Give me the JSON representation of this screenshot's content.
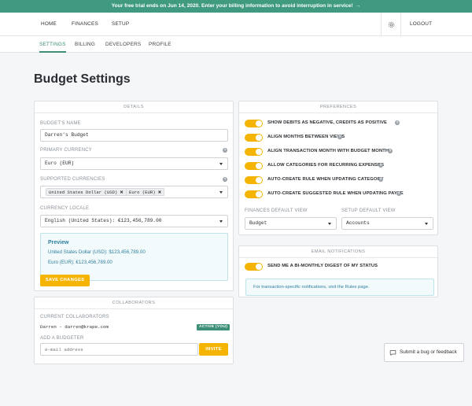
{
  "banner": {
    "text": "Your free trial ends on Jun 14, 2020. Enter your billing information to avoid interruption in service!",
    "arrow": "→"
  },
  "topnav": {
    "home": "HOME",
    "finances": "FINANCES",
    "setup": "SETUP",
    "logout": "LOGOUT",
    "settings_icon": "gear-icon"
  },
  "subnav": {
    "settings": "SETTINGS",
    "billing": "BILLING",
    "developers": "DEVELOPERS",
    "profile": "PROFILE"
  },
  "page": {
    "title": "Budget Settings"
  },
  "details": {
    "header": "DETAILS",
    "budget_name_label": "BUDGET'S NAME",
    "budget_name_value": "Darren's Budget",
    "primary_currency_label": "PRIMARY CURRENCY",
    "primary_currency_value": "Euro (EUR)",
    "supported_currencies_label": "SUPPORTED CURRENCIES",
    "supported_currencies": [
      "United States Dollar (USD)",
      "Euro (EUR)"
    ],
    "currency_locale_label": "CURRENCY LOCALE",
    "currency_locale_value": "English (United States): €123,456,789.00",
    "preview_title": "Preview",
    "preview_lines": [
      "United States Dollar (USD): $123,456,789.00",
      "Euro (EUR): €123,456,789.00"
    ],
    "save_button": "SAVE CHANGES"
  },
  "collaborators": {
    "header": "COLLABORATORS",
    "current_label": "CURRENT COLLABORATORS",
    "current_user": "Darren - darren@krape.com",
    "status_badge": "ACTIVE (YOU)",
    "add_label": "ADD A BUDGETER",
    "email_placeholder": "e-mail address",
    "invite_button": "INVITE"
  },
  "preferences": {
    "header": "PREFERENCES",
    "toggles": [
      {
        "label": "SHOW DEBITS AS NEGATIVE, CREDITS AS POSITIVE",
        "on": true
      },
      {
        "label": "ALIGN MONTHS BETWEEN VIEWS",
        "on": true
      },
      {
        "label": "ALIGN TRANSACTION MONTH WITH BUDGET MONTH",
        "on": true
      },
      {
        "label": "ALLOW CATEGORIES FOR RECURRING EXPENSES",
        "on": true
      },
      {
        "label": "AUTO-CREATE RULE WHEN UPDATING CATEGORY",
        "on": true
      },
      {
        "label": "AUTO-CREATE SUGGESTED RULE WHEN UPDATING PAYEE",
        "on": true
      }
    ],
    "finances_default_view_label": "FINANCES DEFAULT VIEW",
    "finances_default_view_value": "Budget",
    "setup_default_view_label": "SETUP DEFAULT VIEW",
    "setup_default_view_value": "Accounts"
  },
  "email_notifications": {
    "header": "EMAIL NOTIFICATIONS",
    "digest_label": "SEND ME A BI-MONTHLY DIGEST OF MY STATUS",
    "digest_on": true,
    "notice": "For transaction-specific notifications, visit the Rules page."
  },
  "feedback": {
    "label": "Submit a bug or feedback"
  },
  "colors": {
    "accent": "#3d8f77",
    "banner": "#3f9a80",
    "toggle": "#f4b400",
    "preview_text": "#2f7fa1"
  }
}
